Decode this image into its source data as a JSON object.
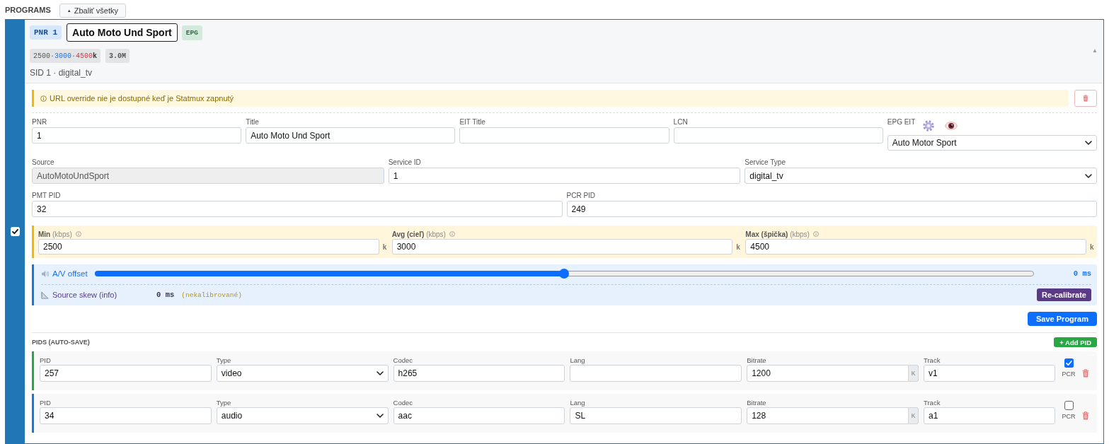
{
  "header": {
    "title": "PROGRAMS",
    "collapse_all": {
      "caret": "▲",
      "label": "Zbaliť všetky"
    }
  },
  "program": {
    "enabled": true,
    "expanded": true,
    "collapse_caret": "▲",
    "pnr_badge": "PNR 1",
    "name_input": {
      "value": "Auto Moto Und Sport",
      "focused": true
    },
    "epg_badge": "EPG",
    "bitrate_chip": [
      {
        "kind": "min",
        "text": "2500"
      },
      {
        "kind": "sep",
        "text": "·"
      },
      {
        "kind": "avg",
        "text": "3000"
      },
      {
        "kind": "sep",
        "text": "·"
      },
      {
        "kind": "max",
        "text": "4500"
      },
      {
        "kind": "unit",
        "text": "k"
      }
    ],
    "size_chip": "3.0M",
    "subtitle": "SID 1 · digital_tv",
    "warning": "URL override nie je dostupné keď je Statmux zapnutý",
    "field_rows": [
      [
        {
          "label": "PNR",
          "kind": "input",
          "value": "1",
          "disabled": false
        },
        {
          "label": "Title",
          "kind": "input",
          "value": "Auto Moto Und Sport",
          "disabled": false
        },
        {
          "label": "EIT Title",
          "kind": "input",
          "disabled": false
        },
        {
          "label": "LCN",
          "kind": "input",
          "disabled": false
        },
        {
          "label": "EPG EIT",
          "kind": "epg_select",
          "value": "Auto Motor Sport",
          "disabled": false
        }
      ],
      [
        {
          "label": "Source",
          "kind": "input",
          "value": "AutoMotoUndSport",
          "disabled": true
        },
        {
          "label": "Service ID",
          "kind": "input",
          "value": "1",
          "disabled": false
        },
        {
          "label": "Service Type",
          "kind": "select",
          "value": "digital_tv",
          "disabled": false
        }
      ],
      [
        {
          "label": "PMT PID",
          "kind": "input",
          "value": "32",
          "disabled": false
        },
        {
          "label": "PCR PID",
          "kind": "input",
          "value": "249",
          "disabled": false
        }
      ]
    ],
    "bitrates": [
      {
        "label": "**Min** (kbps)",
        "value": "2500",
        "unit": "k"
      },
      {
        "label": "**Avg (cieľ)** (kbps)",
        "value": "3000",
        "unit": "k"
      },
      {
        "label": "**Max (špička)** (kbps)",
        "value": "4500",
        "unit": "k"
      }
    ],
    "av_offset": {
      "label": "A/V offset",
      "level": 0.5,
      "reading": "0 ms"
    },
    "source_skew": {
      "label": "Source skew (info)",
      "value": "0 ms",
      "note": "(nekalibrované)",
      "button": "Re-calibrate"
    },
    "save_button": "Save Program",
    "pids": {
      "title": "PIDS (AUTO-SAVE)",
      "add_button": "+ Add PID",
      "rows": [
        {
          "color": "#28a745",
          "fields": [
            {
              "label": "PID",
              "kind": "input",
              "value": "257"
            },
            {
              "label": "Type",
              "kind": "select",
              "value": "video"
            },
            {
              "label": "Codec",
              "kind": "input",
              "value": "h265"
            },
            {
              "label": "Lang",
              "kind": "input"
            },
            {
              "label": "Bitrate",
              "kind": "addon",
              "value": "1200",
              "addon": "K"
            },
            {
              "label": "Track",
              "kind": "input",
              "value": "v1"
            }
          ],
          "pcr": {
            "label": "PCR",
            "checked": true
          }
        },
        {
          "color": "#1a73e8",
          "fields": [
            {
              "label": "PID",
              "kind": "input",
              "value": "34"
            },
            {
              "label": "Type",
              "kind": "select",
              "value": "audio"
            },
            {
              "label": "Codec",
              "kind": "input",
              "value": "aac"
            },
            {
              "label": "Lang",
              "kind": "input",
              "value": "SL"
            },
            {
              "label": "Bitrate",
              "kind": "addon",
              "value": "128",
              "addon": "K"
            },
            {
              "label": "Track",
              "kind": "input",
              "value": "a1"
            }
          ],
          "pcr": {
            "label": "PCR",
            "checked": false
          }
        }
      ]
    }
  }
}
